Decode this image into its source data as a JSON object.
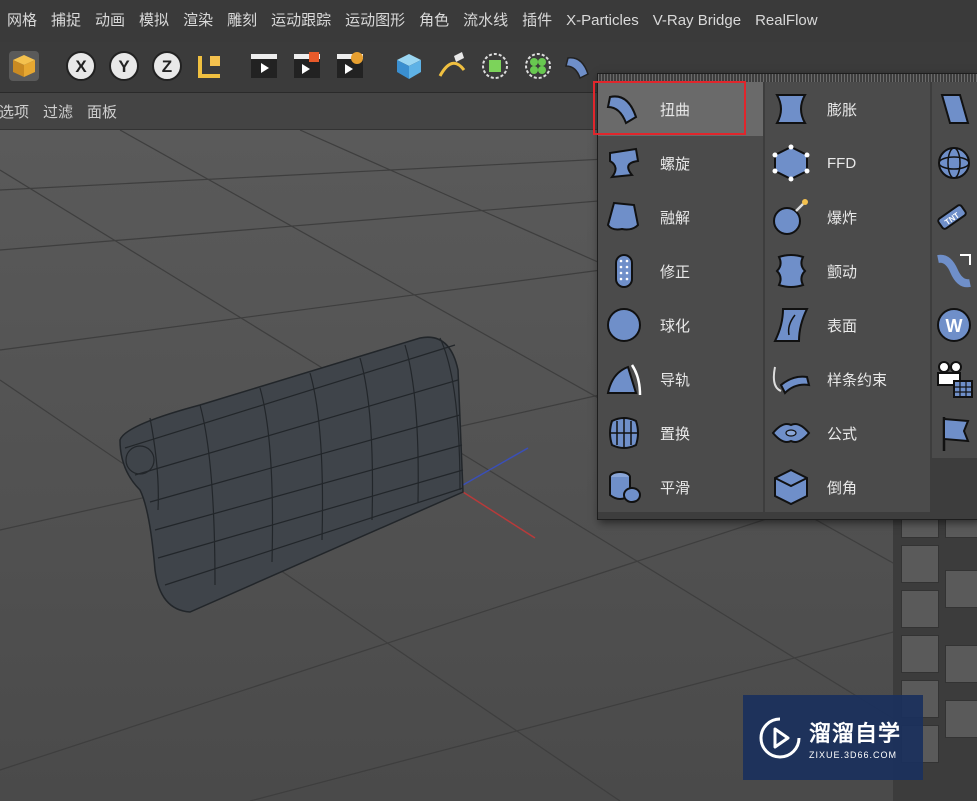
{
  "menubar": {
    "items": [
      "网格",
      "捕捉",
      "动画",
      "模拟",
      "渲染",
      "雕刻",
      "运动跟踪",
      "运动图形",
      "角色",
      "流水线",
      "插件",
      "X-Particles",
      "V-Ray Bridge",
      "RealFlow"
    ]
  },
  "subbar": {
    "items": [
      "选项",
      "过滤",
      "面板"
    ]
  },
  "toolbar": {
    "icons": [
      "cube-object-icon",
      "x-axis-lock-icon",
      "y-axis-lock-icon",
      "z-axis-lock-icon",
      "coordinate-system-icon",
      "render-view-icon",
      "render-picture-viewer-icon",
      "render-settings-icon",
      "cube-primitive-icon",
      "pen-spline-icon",
      "subdivision-icon",
      "mograph-cloner-icon",
      "deformer-bend-icon"
    ]
  },
  "deformer_menu": {
    "columns": [
      {
        "items": [
          {
            "label": "扭曲",
            "icon": "bend-icon",
            "selected": true
          },
          {
            "label": "螺旋",
            "icon": "twist-icon"
          },
          {
            "label": "融解",
            "icon": "melt-icon"
          },
          {
            "label": "修正",
            "icon": "correction-icon"
          },
          {
            "label": "球化",
            "icon": "spherify-icon"
          },
          {
            "label": "导轨",
            "icon": "rail-icon"
          },
          {
            "label": "置换",
            "icon": "displacer-icon"
          },
          {
            "label": "平滑",
            "icon": "smoothing-icon"
          }
        ]
      },
      {
        "items": [
          {
            "label": "膨胀",
            "icon": "bulge-icon"
          },
          {
            "label": "FFD",
            "icon": "ffd-icon"
          },
          {
            "label": "爆炸",
            "icon": "explosion-icon"
          },
          {
            "label": "颤动",
            "icon": "jiggle-icon"
          },
          {
            "label": "表面",
            "icon": "surface-icon"
          },
          {
            "label": "样条约束",
            "icon": "spline-wrap-icon"
          },
          {
            "label": "公式",
            "icon": "formula-icon"
          },
          {
            "label": "倒角",
            "icon": "bevel-icon"
          }
        ]
      },
      {
        "items": [
          {
            "icon": "shear-icon"
          },
          {
            "icon": "mesh-deformer-icon"
          },
          {
            "icon": "tnt-explosion-icon"
          },
          {
            "icon": "camera-deformer-icon"
          },
          {
            "icon": "wind-icon"
          },
          {
            "icon": "camera-clip-icon"
          },
          {
            "icon": "flag-icon"
          }
        ]
      }
    ]
  },
  "watermark": {
    "title": "溜溜自学",
    "url": "ZIXUE.3D66.COM"
  },
  "colors": {
    "highlight": "#e0262c",
    "icon_blue": "#6f8fc9",
    "watermark_bg": "#1b305c"
  }
}
